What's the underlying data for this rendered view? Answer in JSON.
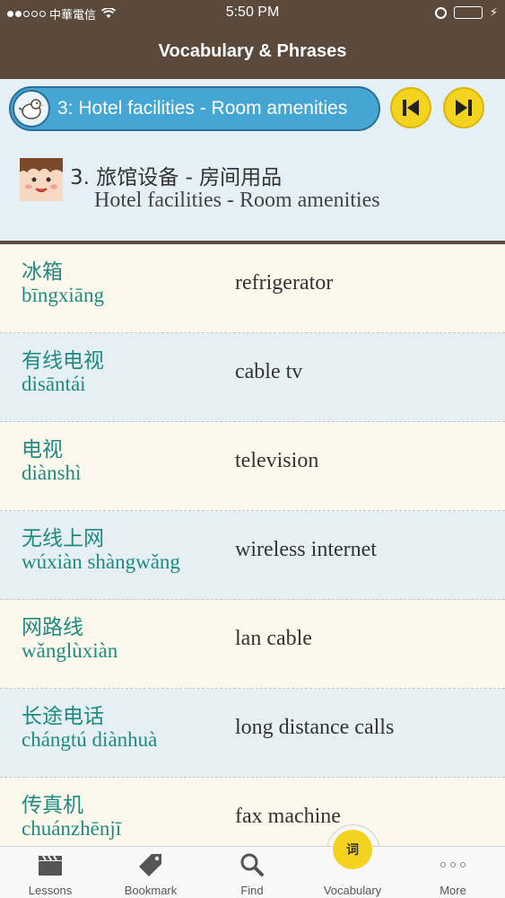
{
  "status_bar": {
    "carrier": "中華電信",
    "time": "5:50 PM",
    "wifi_icon": "wifi-icon",
    "battery_color": "#6fe050"
  },
  "nav": {
    "title": "Vocabulary & Phrases"
  },
  "lesson": {
    "selector_label": "3: Hotel facilities - Room amenities",
    "title_zh": "3. 旅馆设备 - 房间用品",
    "title_en": "Hotel facilities - Room amenities"
  },
  "vocabulary": [
    {
      "zh": "冰箱",
      "pinyin": "bīngxiāng",
      "en": "refrigerator"
    },
    {
      "zh": "有线电视",
      "pinyin": "disāntái",
      "en": "cable tv"
    },
    {
      "zh": "电视",
      "pinyin": "diànshì",
      "en": "television"
    },
    {
      "zh": "无线上网",
      "pinyin": "wúxiàn shàngwǎng",
      "en": "wireless internet"
    },
    {
      "zh": "网路线",
      "pinyin": "wǎnglùxiàn",
      "en": "lan cable"
    },
    {
      "zh": "长途电话",
      "pinyin": "chángtú diànhuà",
      "en": "long distance calls"
    },
    {
      "zh": "传真机",
      "pinyin": "chuánzhēnjī",
      "en": "fax machine"
    }
  ],
  "tabs": {
    "lessons": "Lessons",
    "bookmark": "Bookmark",
    "find": "Find",
    "vocabulary": "Vocabulary",
    "vocabulary_badge": "词",
    "more": "More"
  },
  "colors": {
    "brand_brown": "#5b4a3c",
    "accent_blue": "#45a6d4",
    "accent_yellow": "#f4d31f",
    "word_teal": "#1e8b82"
  }
}
